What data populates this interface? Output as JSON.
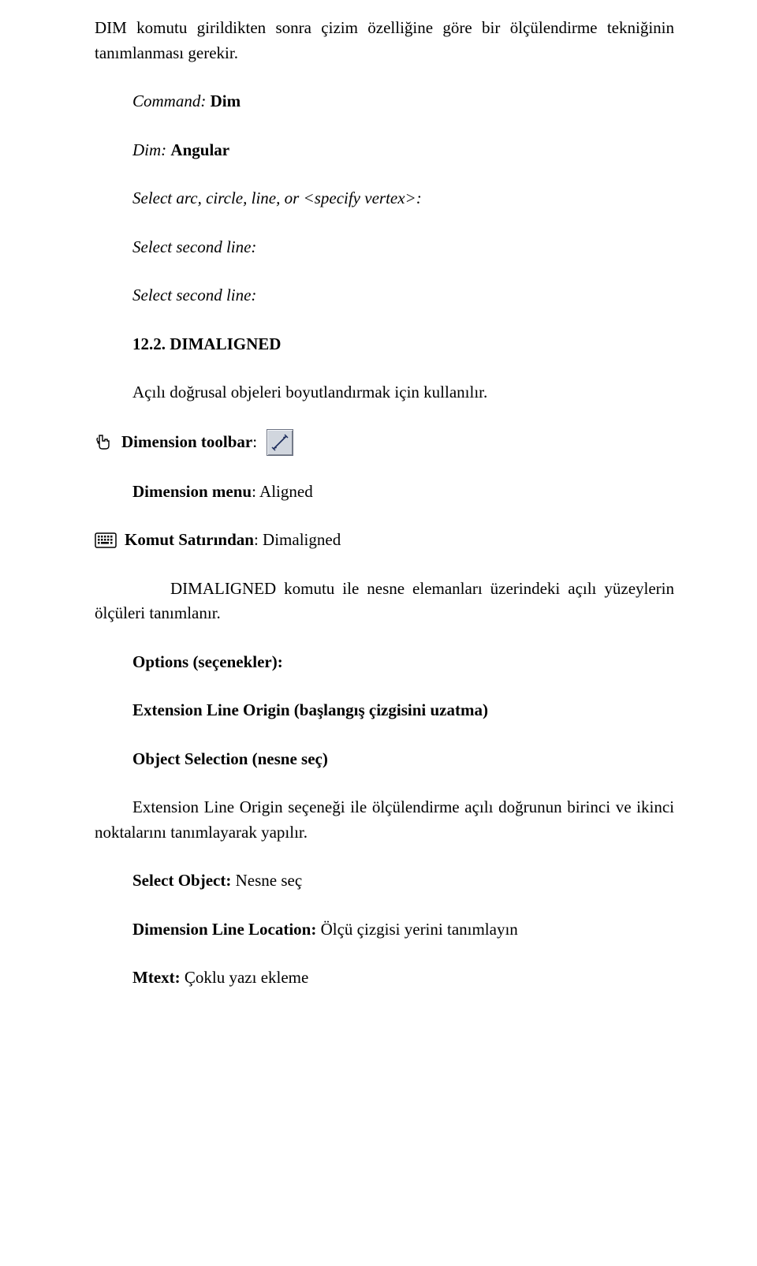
{
  "intro": {
    "prefix": "DIM komutu girildikten sonra çizim özelliğine göre bir ölçülendirme tekniğinin tanımlanması gerekir."
  },
  "cmd1": {
    "commandLabel": "Command",
    "commandValue": "Dim",
    "dimLabel": "Dim",
    "dimValue": "Angular",
    "selectArc": "Select arc, circle, line, or <specify vertex>:",
    "secondLine1": "Select second line:",
    "secondLine2": "Select second line:"
  },
  "section": {
    "number": "12.2. DIMALIGNED",
    "desc": "Açılı doğrusal objeleri boyutlandırmak için kullanılır."
  },
  "toolbar": {
    "label": "Dimension toolbar",
    "colon": ":"
  },
  "menu": {
    "label": "Dimension menu",
    "value": "Aligned"
  },
  "cmdline": {
    "label": "Komut Satırından",
    "value": "Dimaligned"
  },
  "body1": "DIMALIGNED komutu ile nesne elemanları üzerindeki açılı yüzeylerin ölçüleri tanımlanır.",
  "options": {
    "heading": "Options (seçenekler):",
    "ext": "Extension Line Origin (başlangış çizgisini uzatma)",
    "obj": "Object Selection (nesne seç)"
  },
  "body2": "Extension Line Origin seçeneği ile ölçülendirme açılı doğrunun birinci ve ikinci noktalarını tanımlayarak yapılır.",
  "selectObj": {
    "label": "Select Object:",
    "value": "Nesne seç"
  },
  "dimLoc": {
    "label": "Dimension Line Location:",
    "value": "Ölçü çizgisi yerini tanımlayın"
  },
  "mtext": {
    "label": "Mtext:",
    "value": "Çoklu yazı ekleme"
  }
}
